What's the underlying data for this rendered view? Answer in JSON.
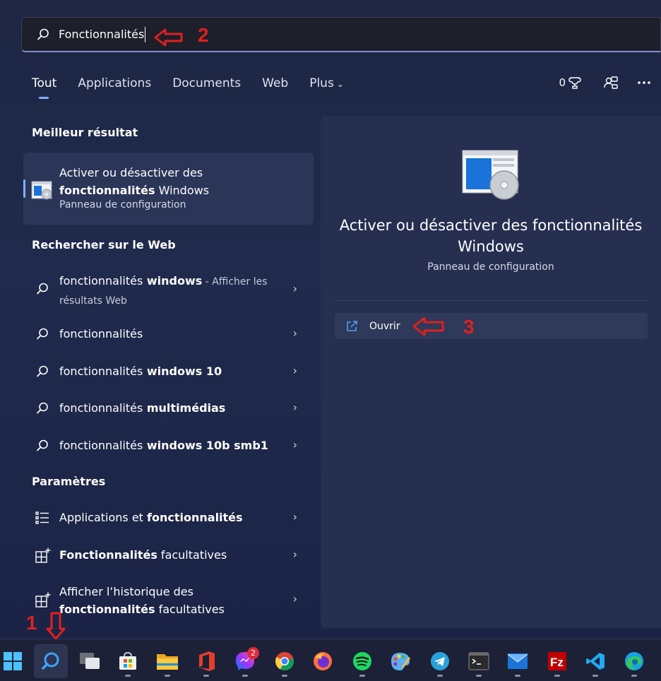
{
  "search": {
    "value": "Fonctionnalités"
  },
  "annotations": {
    "a1": "1",
    "a2": "2",
    "a3": "3"
  },
  "tabs": [
    {
      "label": "Tout",
      "active": true
    },
    {
      "label": "Applications"
    },
    {
      "label": "Documents"
    },
    {
      "label": "Web"
    },
    {
      "label": "Plus"
    }
  ],
  "top_right": {
    "points": "0"
  },
  "sections": {
    "best": "Meilleur résultat",
    "web": "Rechercher sur le Web",
    "settings": "Paramètres"
  },
  "best_result": {
    "line1": "Activer ou désactiver des",
    "line2_bold": "fonctionnalités",
    "line2_rest": " Windows",
    "subtitle": "Panneau de configuration"
  },
  "web_results": [
    {
      "bold_prefix": "",
      "normal": "fonctionnalités",
      "bold": " windows",
      "suffix": " - Afficher les résultats Web"
    },
    {
      "normal": "fonctionnalités",
      "bold": ""
    },
    {
      "normal": "fonctionnalités",
      "bold": " windows 10"
    },
    {
      "normal": "fonctionnalités",
      "bold": " multimédias"
    },
    {
      "normal": "fonctionnalités",
      "bold": " windows 10b smb1"
    }
  ],
  "settings": [
    {
      "normal": "Applications et ",
      "bold": "fonctionnalités",
      "after": ""
    },
    {
      "normal": "",
      "bold": "Fonctionnalités",
      "after": " facultatives"
    },
    {
      "normal": "Afficher l’historique des",
      "bold": "fonctionnalités",
      "after": " facultatives"
    }
  ],
  "detail": {
    "title_line1": "Activer ou désactiver des fonctionnalités",
    "title_line2": "Windows",
    "subtitle": "Panneau de configuration",
    "open_label": "Ouvrir"
  },
  "taskbar": {
    "messenger_badge": "2",
    "icons": [
      "start-icon",
      "search-icon",
      "task-view-icon",
      "store-icon",
      "file-explorer-icon",
      "office-icon",
      "messenger-icon",
      "chrome-icon",
      "firefox-icon",
      "spotify-icon",
      "paint-icon",
      "telegram-icon",
      "terminal-icon",
      "mail-icon",
      "filezilla-icon",
      "vscode-icon",
      "edge-icon"
    ]
  },
  "colors": {
    "accent": "#7fb1ff",
    "annotation": "#e0201e"
  }
}
